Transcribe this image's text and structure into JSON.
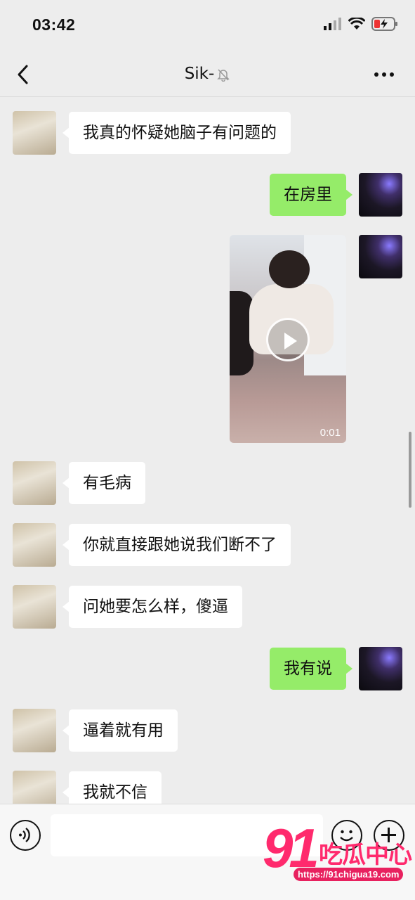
{
  "status_bar": {
    "time": "03:42"
  },
  "header": {
    "title": "Sik-"
  },
  "messages": [
    {
      "side": "left",
      "text": "我真的怀疑她脑子有问题的"
    },
    {
      "side": "right",
      "text": "在房里"
    },
    {
      "side": "right",
      "type": "video",
      "duration": "0:01"
    },
    {
      "side": "left",
      "text": "有毛病"
    },
    {
      "side": "left",
      "text": "你就直接跟她说我们断不了"
    },
    {
      "side": "left",
      "text": "问她要怎么样，傻逼"
    },
    {
      "side": "right",
      "text": "我有说"
    },
    {
      "side": "left",
      "text": "逼着就有用"
    },
    {
      "side": "left",
      "text": "我就不信"
    }
  ],
  "input": {
    "value": ""
  },
  "watermark": {
    "number": "91",
    "name": "吃瓜中心",
    "url": "https://91chigua19.com"
  },
  "colors": {
    "background": "#ededed",
    "sent_bubble": "#95ec69",
    "received_bubble": "#ffffff",
    "watermark": "#ff2a6d"
  }
}
